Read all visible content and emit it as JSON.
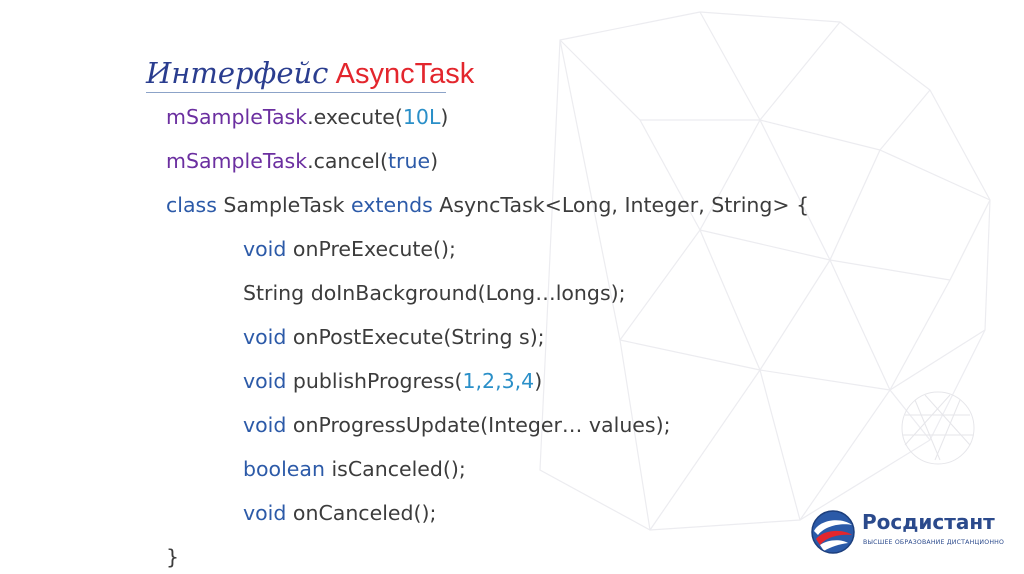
{
  "title": {
    "ru": "Интерфейс",
    "en": "AsyncTask"
  },
  "code": {
    "line1": {
      "obj": "mSampleTask",
      "dot": ".execute(",
      "arg": "10L",
      "close": ")"
    },
    "line2": {
      "obj": "mSampleTask",
      "dot": ".cancel(",
      "arg": "true",
      "close": ")"
    },
    "line3": {
      "kw1": "class",
      "name": " SampleTask ",
      "kw2": "extends",
      "rest": " AsyncTask<Long, Integer, String> {"
    },
    "line4": {
      "kw": "void",
      "rest": " onPreExecute();"
    },
    "line5": {
      "text": "String doInBackground(Long…longs);"
    },
    "line6": {
      "kw": "void",
      "rest": " onPostExecute(String s);"
    },
    "line7": {
      "kw": "void",
      "pre": " publishProgress(",
      "args": "1,2,3,4",
      "close": ")"
    },
    "line8": {
      "kw": "void",
      "rest": " onProgressUpdate(Integer… values);"
    },
    "line9": {
      "kw": "boolean",
      "rest": " isCanceled();"
    },
    "line10": {
      "kw": "void",
      "rest": " onCanceled();"
    },
    "line11": {
      "text": "}"
    }
  },
  "logo": {
    "name": "Росдистант",
    "tagline": "ВЫСШЕЕ ОБРАЗОВАНИЕ ДИСТАНЦИОННО"
  },
  "colors": {
    "keyword": "#2c5aa8",
    "identifier": "#6b2fa0",
    "number": "#2a8fc8",
    "title_ru": "#2a3d8f",
    "title_en": "#e3262d"
  }
}
